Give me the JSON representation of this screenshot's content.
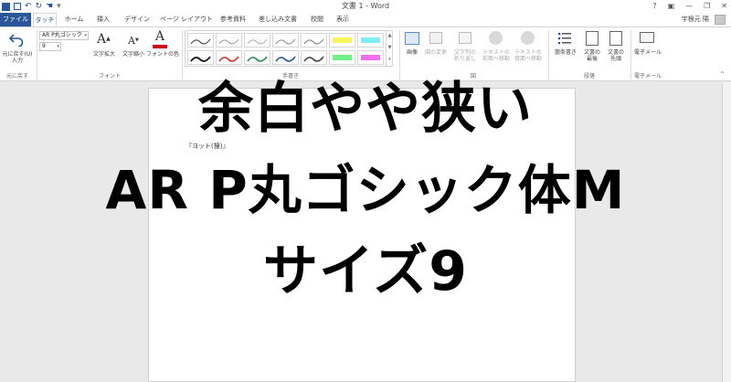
{
  "titlebar": {
    "qat": {
      "undo": "↶",
      "redo": "↻",
      "touch": "☚",
      "customize": "▾"
    },
    "title": "文書 1 - Word",
    "controls": {
      "help": "?",
      "ribbon_options": "▣",
      "minimize": "—",
      "restore": "❐",
      "close": "✕"
    }
  },
  "tabs": {
    "file": "ファイル",
    "items": [
      "タッチ",
      "ホーム",
      "挿入",
      "デザイン",
      "ページ レイアウト",
      "参考資料",
      "差し込み文書",
      "校閲",
      "表示"
    ],
    "user": "宇根元 陽"
  },
  "ribbon": {
    "undo_group": {
      "button_label_1": "元に戻す(U)",
      "button_label_2": "入力",
      "group_label": "元に戻す"
    },
    "font_group": {
      "font_name": "AR P丸ゴシック",
      "font_size": "9",
      "grow_label": "文字拡大",
      "shrink_label": "文字縮小",
      "color_label": "フォントの色",
      "group_label": "フォント"
    },
    "pens_group": {
      "group_label": "手書き"
    },
    "picture_group": {
      "picture_label": "画像",
      "change_label": "図の変更",
      "wrap_label_1": "文字列の",
      "wrap_label_2": "折り返し",
      "front_label_1": "テキストの",
      "front_label_2": "前面へ移動",
      "back_label_1": "テキストの",
      "back_label_2": "背面へ移動",
      "group_label": "図"
    },
    "paragraph_group": {
      "bullets_label": "箇条書き",
      "end_label_1": "文書の",
      "end_label_2": "最後",
      "start_label_1": "文書の",
      "start_label_2": "先頭",
      "group_label": "段落"
    },
    "email_group": {
      "email_label": "電子メール",
      "group_label": "電子メール"
    }
  },
  "document": {
    "body_text": "『ヨット(捜)』"
  },
  "overlay": {
    "line1": "余白やや狭い",
    "line2": "AR P丸ゴシック体M",
    "line3": "サイズ9"
  },
  "colors": {
    "accent": "#2b579a",
    "font_color_bar": "#d0021b",
    "highlight_yellow": "#f7f75b",
    "highlight_cyan": "#7ff0ef",
    "highlight_green": "#6ff08a",
    "highlight_magenta": "#f36ef3"
  }
}
